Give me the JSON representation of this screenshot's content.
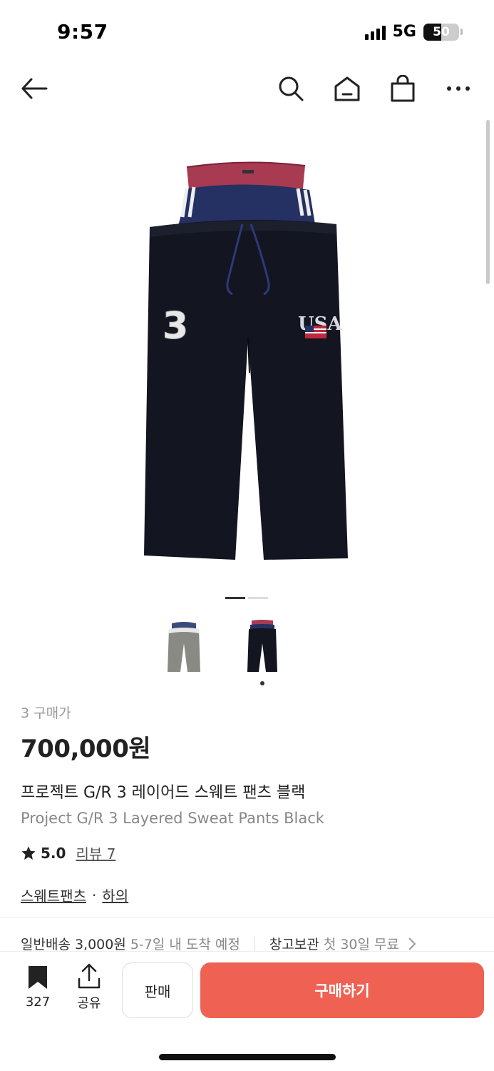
{
  "status_bar": {
    "time": "9:57",
    "network": "5G",
    "battery": "50",
    "battery_level": 0.5
  },
  "nav": {
    "back_icon": "arrow-left-icon",
    "search_icon": "search-icon",
    "home_icon": "home-icon",
    "bag_icon": "shopping-bag-icon",
    "more_icon": "more-icon"
  },
  "product": {
    "image_pager": {
      "total": 2,
      "active": 1
    },
    "thumbnails": [
      {
        "name": "thumbnail-gray",
        "selected": false
      },
      {
        "name": "thumbnail-black",
        "selected": true
      }
    ],
    "price_label": "3 구매가",
    "price": "700,000원",
    "name_ko": "프로젝트 G/R 3 레이어드 스웨트 팬츠 블랙",
    "name_en": "Project G/R 3 Layered Sweat Pants Black",
    "rating": "5.0",
    "review_label": "리뷰 7",
    "categories": [
      "스웨트팬츠",
      "하의"
    ],
    "category_separator": "·"
  },
  "delivery": {
    "shipping": "일반배송 3,000원",
    "shipping_eta": "5-7일 내 도착 예정",
    "storage": "창고보관",
    "storage_note": "첫 30일 무료"
  },
  "bottom_bar": {
    "save_count": "327",
    "share_label": "공유",
    "sell_label": "판매",
    "buy_label": "구매하기"
  },
  "colors": {
    "accent": "#ef6253",
    "text": "#222222",
    "muted": "#888888"
  }
}
